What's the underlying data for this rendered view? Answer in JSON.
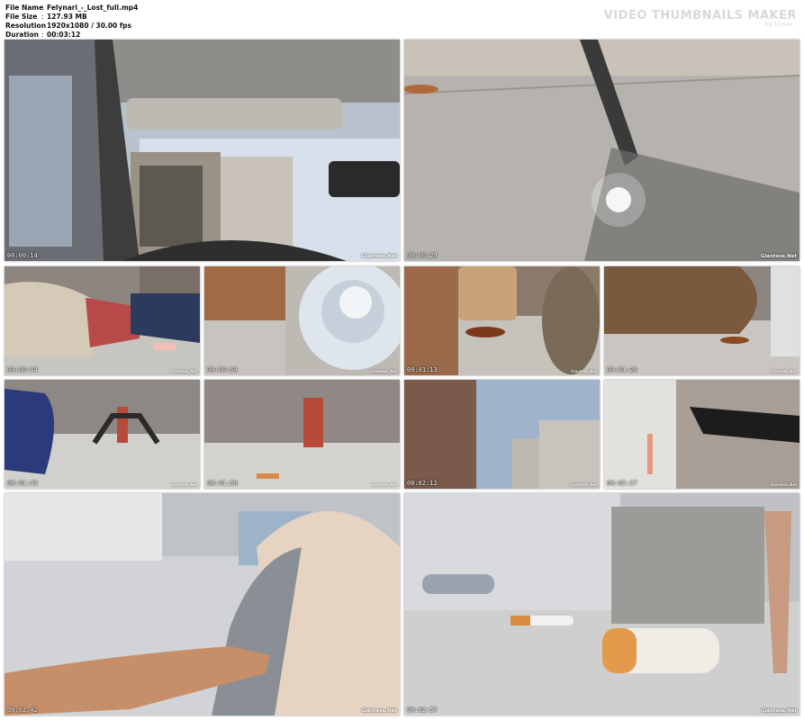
{
  "file_info": {
    "file_name_label": "File Name",
    "file_name": "Felynari_-_Lost_full.mp4",
    "file_size_label": "File Size",
    "file_size": "127.93 MB",
    "resolution_label": "Resolution",
    "resolution": "1920x1080 / 30.00 fps",
    "duration_label": "Duration",
    "duration": "00:03:12",
    "separator": ":"
  },
  "brand": {
    "title": "VIDEO THUMBNAILS MAKER",
    "subtitle": "by Vanex"
  },
  "watermark": "Giantess.Net",
  "thumbnails": [
    {
      "id": "car-interior",
      "time": "00:00:14"
    },
    {
      "id": "pavement-closeup",
      "time": "00:00:29"
    },
    {
      "id": "rock-and-can",
      "time": "00:00:44"
    },
    {
      "id": "bottle-cap-giant",
      "time": "00:00:59"
    },
    {
      "id": "rusty-can-cap",
      "time": "00:01:13"
    },
    {
      "id": "rusty-can-side",
      "time": "00:01:28"
    },
    {
      "id": "can-hydrant",
      "time": "00:01:43"
    },
    {
      "id": "hydrant-cigarette",
      "time": "00:01:58"
    },
    {
      "id": "city-buildings",
      "time": "00:02:12"
    },
    {
      "id": "wall-legs",
      "time": "00:02:27"
    },
    {
      "id": "arm-holding-cap",
      "time": "00:02:42"
    },
    {
      "id": "cigarettes-can-legs",
      "time": "00:02:57"
    }
  ]
}
